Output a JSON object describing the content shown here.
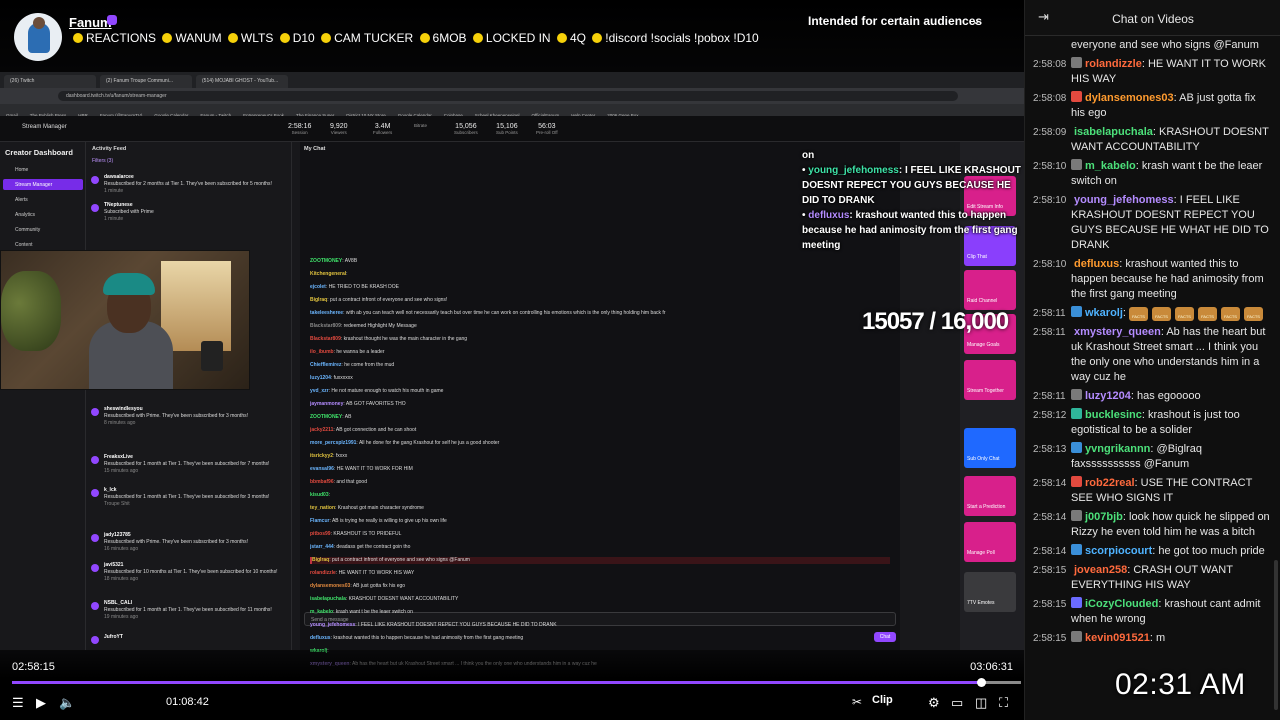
{
  "channel": {
    "name": "Fanum",
    "title_segments": [
      "REACTIONS",
      "WANUM",
      "WLTS",
      "D10",
      "CAM TUCKER",
      "6MOB",
      "LOCKED IN",
      "4Q"
    ],
    "title_tail": "!discord !socials !pobox !D10",
    "audience_notice": "Intended for certain audiences"
  },
  "browser": {
    "tabs": [
      "(26) Twitch",
      "(2) Fanum Troupe Communi...",
      "(514) MOJABI GHOST - YouTub..."
    ],
    "url": "dashboard.twitch.tv/u/fanum/stream-manager",
    "bookmarks": [
      "Gmail",
      "The Publish Press",
      "HBR",
      "Fanum (@FanumTV)",
      "Google Calendar",
      "Fanum - Twitch",
      "Entrepreneur's Book",
      "The Finance Super",
      "District 10 NY Store",
      "Google Calendar",
      "Coinbase",
      "Scheel Kheenerweipel",
      "OfficialFanum",
      "Help Center",
      "2006 Gene Box"
    ]
  },
  "stream_manager": {
    "title": "Stream Manager",
    "stats": [
      {
        "value": "2:58:16",
        "label": "Session"
      },
      {
        "value": "9,920",
        "label": "Viewers"
      },
      {
        "value": "3.4M",
        "label": "Followers"
      },
      {
        "value": "",
        "label": "Bitrate"
      },
      {
        "value": "15,056",
        "label": "Subscribers"
      },
      {
        "value": "15,106",
        "label": "Sub Points"
      },
      {
        "value": "56:03",
        "label": "Pre-roll Off"
      }
    ],
    "sidebar_title": "Creator Dashboard",
    "sidebar_items": [
      "Home",
      "Stream Manager",
      "Alerts",
      "Analytics",
      "Community",
      "Content"
    ],
    "activity_title": "Activity Feed",
    "activity_filter": "Filters (3)",
    "activity": [
      {
        "user": "dawsalarcee",
        "text": "Resubscribed for 2 months at Tier 1. They've been subscribed for 5 months!",
        "time": "1 minute"
      },
      {
        "user": "TNeptunese",
        "text": "Subscribed with Prime",
        "time": "1 minute"
      },
      {
        "user": "sheswindlesyou",
        "text": "Resubscribed with Prime. They've been subscribed for 3 months!",
        "time": "8 minutes ago"
      },
      {
        "user": "FreaksxLive",
        "text": "Resubscribed for 1 month at Tier 1. They've been subscribed for 7 months!",
        "time": "15 minutes ago"
      },
      {
        "user": "k_lck",
        "text": "Resubscribed for 1 month at Tier 1. They've been subscribed for 3 months!",
        "time": "Troupe Shit"
      },
      {
        "user": "jady123785",
        "text": "Resubscribed with Prime. They've been subscribed for 3 months!",
        "time": "16 minutes ago"
      },
      {
        "user": "javi5321",
        "text": "Resubscribed for 10 months at Tier 1. They've been subscribed for 10 months!",
        "time": "18 minutes ago"
      },
      {
        "user": "NSBL_CALI",
        "text": "Resubscribed for 1 month at Tier 1. They've been subscribed for 11 months!",
        "time": "19 minutes ago"
      },
      {
        "user": "JufroYT",
        "text": "",
        "time": ""
      }
    ],
    "my_chat_title": "My Chat",
    "chat_lines": [
      {
        "user": "ZOOTMONEY",
        "text": "AV8B",
        "color": "#3fe26a"
      },
      {
        "user": "Kitchengeneral",
        "text": "",
        "color": "#e2c43f"
      },
      {
        "user": "ejcolet",
        "text": "HE TRIED TO BE KRASH DOE",
        "color": "#6bb6ff"
      },
      {
        "user": "Biglraq",
        "text": "put a contract infront of everyone and see who signs!",
        "color": "#e2c43f"
      },
      {
        "user": "takeleesheree",
        "text": "with ab you can teach well not necessarily teach but over time he can work on controlling his emotions which is the only thing holding him back fr",
        "color": "#6bb6ff"
      },
      {
        "user": "Blackstar809",
        "text": "redeemed Highlight My Message",
        "color": "#888888"
      },
      {
        "user": "Blackstar809",
        "text": "krashout thought he was the main character in the gang",
        "color": "#e24a3f"
      },
      {
        "user": "ilo_ibumb",
        "text": "he wanna be a leader",
        "color": "#e24a3f"
      },
      {
        "user": "Chiefflemirez",
        "text": "he come from the mud",
        "color": "#6bb6ff"
      },
      {
        "user": "luzy1204",
        "text": "fuxxxxxx",
        "color": "#6bb6ff"
      },
      {
        "user": "yvd_xzr",
        "text": "He not mature enough to watch his mouth in game",
        "color": "#6bb6ff"
      },
      {
        "user": "jaymanmoney",
        "text": "AB GOT FAVORITES THO",
        "color": "#b48cff"
      },
      {
        "user": "ZOOTMONEY",
        "text": "AB",
        "color": "#3fe26a"
      },
      {
        "user": "jacky2211",
        "text": "AB got connection and he can shoot",
        "color": "#e24a3f"
      },
      {
        "user": "more_percsplz1991",
        "text": "All he done for the gang Krashout for self he jus a good shooter",
        "color": "#6bb6ff"
      },
      {
        "user": "itsrickyy2",
        "text": "fxxxx",
        "color": "#e2c43f"
      },
      {
        "user": "evansal96",
        "text": "HE WANT IT TO WORK FOR HIM",
        "color": "#6bb6ff"
      },
      {
        "user": "bbmbaf96",
        "text": "and that good",
        "color": "#e24a3f"
      },
      {
        "user": "kisud03",
        "text": "",
        "color": "#3fe26a"
      },
      {
        "user": "tey_nation",
        "text": "Krashout got main character syndrome",
        "color": "#e2c43f"
      },
      {
        "user": "Flamcur",
        "text": "AB is trying he really is willing to give up his own life",
        "color": "#6bb6ff"
      },
      {
        "user": "pitbos99",
        "text": "KRASHOUT IS TO PRIDEFUL",
        "color": "#e24a3f"
      },
      {
        "user": "jstarr_444",
        "text": "deadass get the contract goin tho",
        "color": "#6bb6ff"
      },
      {
        "user": "Biglraq",
        "text": "put a contract infront of everyone and see who signs @Fanum",
        "color": "#e2c43f"
      },
      {
        "user": "rolandizzle",
        "text": "HE WANT IT TO WORK HIS WAY",
        "color": "#e24a3f"
      },
      {
        "user": "dylansemones03",
        "text": "AB just gotta fix his ego",
        "color": "#e28a3f"
      },
      {
        "user": "isabelapuchala",
        "text": "KRASHOUT DOESNT WANT ACCOUNTABILITY",
        "color": "#3fe26a"
      },
      {
        "user": "m_kabelo",
        "text": "krash want t be the leaer switch on",
        "color": "#3fe26a"
      },
      {
        "user": "young_jefehomess",
        "text": "I FEEL LIKE KRASHOUT DOESNT REPECT YOU GUYS BECAUSE HE DID TO DRANK",
        "color": "#b48cff"
      },
      {
        "user": "defluxus",
        "text": "krashout wanted this to happen because he had animosity from the first gang meeting",
        "color": "#6bb6ff"
      },
      {
        "user": "wkarolj",
        "text": "",
        "color": "#3fe26a"
      },
      {
        "user": "xmystery_queen",
        "text": "Ab has the heart but uk Krashout Street smart ... I think you the only one who understands him in a way cuz he",
        "color": "#b48cff"
      }
    ],
    "send_placeholder": "Send a message",
    "chat_button": "Chat",
    "quick_actions": [
      "Edit Stream Info",
      "Clip That",
      "Raid Channel",
      "Manage Goals",
      "Stream Together",
      "Sub Only Chat",
      "Start a Prediction",
      "Manage Poll",
      "7TV Emotes"
    ]
  },
  "overlay": {
    "partial_line": "on",
    "messages": [
      {
        "user": "young_jefehomess",
        "text": "I FEEL LIKE KRASHOUT DOESNT REPECT YOU GUYS BECAUSE HE DID TO DRANK"
      },
      {
        "user": "defluxus",
        "text": "krashout wanted this to happen because he had animosity from the first gang meeting"
      }
    ],
    "goal_counter": "15057 / 16,000"
  },
  "player": {
    "elapsed": "02:58:15",
    "total": "03:06:31",
    "current_position": "01:08:42",
    "progress_fraction": 0.969,
    "buffered_fraction": 0.04,
    "clip_label": "Clip"
  },
  "chat_panel": {
    "title": "Chat on Videos",
    "messages": [
      {
        "ts": "",
        "user": "",
        "color": "#e6e6e6",
        "badge": "",
        "text": "everyone and see who signs @Fanum"
      },
      {
        "ts": "2:58:08",
        "user": "rolandizzle",
        "color": "#ff6a3d",
        "badge": "#7a7a7a",
        "text": "HE WANT IT TO WORK HIS WAY"
      },
      {
        "ts": "2:58:08",
        "user": "dylansemones03",
        "color": "#ff9b2f",
        "badge": "#e24a3f",
        "text": "AB just gotta fix his ego"
      },
      {
        "ts": "2:58:09",
        "user": "isabelapuchala",
        "color": "#4ce07a",
        "badge": "",
        "text": "KRASHOUT DOESNT WANT ACCOUNTABILITY"
      },
      {
        "ts": "2:58:10",
        "user": "m_kabelo",
        "color": "#4ce07a",
        "badge": "#7a7a7a",
        "text": "krash want t be the leaer switch on"
      },
      {
        "ts": "2:58:10",
        "user": "young_jefehomess",
        "color": "#b48cff",
        "badge": "",
        "text": "I FEEL LIKE KRASHOUT DOESNT REPECT YOU GUYS BECAUSE HE WHAT HE DID TO DRANK"
      },
      {
        "ts": "2:58:10",
        "user": "defluxus",
        "color": "#ff9b2f",
        "badge": "",
        "text": "krashout wanted this to happen because he had animosity from the first gang meeting"
      },
      {
        "ts": "2:58:11",
        "user": "wkarolj",
        "color": "#4fb3ff",
        "badge": "#3a8fd8",
        "text": "",
        "emotes": 6,
        "emote_label": "FACTS"
      },
      {
        "ts": "2:58:11",
        "user": "xmystery_queen",
        "color": "#b48cff",
        "badge": "",
        "text": "Ab has the heart but uk Krashout Street smart ... I think you the only one who understands him in a way cuz he"
      },
      {
        "ts": "2:58:11",
        "user": "luzy1204",
        "color": "#b48cff",
        "badge": "#7a7a7a",
        "text": "has egooooo"
      },
      {
        "ts": "2:58:12",
        "user": "bucklesinc",
        "color": "#4ce07a",
        "badge": "#2fb59a",
        "text": "krashout is just too egotistical to be a solider"
      },
      {
        "ts": "2:58:13",
        "user": "yvngrikannn",
        "color": "#4ce07a",
        "badge": "#3a8fd8",
        "text": "@Biglraq faxssssssssss @Fanum"
      },
      {
        "ts": "2:58:14",
        "user": "rob22real",
        "color": "#ff6a3d",
        "badge": "#e24a3f",
        "text": "USE THE CONTRACT SEE WHO SIGNS IT"
      },
      {
        "ts": "2:58:14",
        "user": "j007bjb",
        "color": "#4ce07a",
        "badge": "#7a7a7a",
        "text": "look how quick he slipped on Rizzy he even told him he was a bitch"
      },
      {
        "ts": "2:58:14",
        "user": "scorpiocourt",
        "color": "#4fb3ff",
        "badge": "#3a8fd8",
        "text": "he got too much pride"
      },
      {
        "ts": "2:58:15",
        "user": "jovean258",
        "color": "#ff6a3d",
        "badge": "",
        "text": "CRASH OUT WANT EVERYTHING HIS WAY"
      },
      {
        "ts": "2:58:15",
        "user": "iCozyClouded",
        "color": "#4ce07a",
        "badge": "#6b6bff",
        "text": "krashout cant admit when he wrong"
      },
      {
        "ts": "2:58:15",
        "user": "kevin091521",
        "color": "#ff6a3d",
        "badge": "#7a7a7a",
        "text": "m"
      }
    ]
  },
  "clock_overlay": "02:31 AM"
}
